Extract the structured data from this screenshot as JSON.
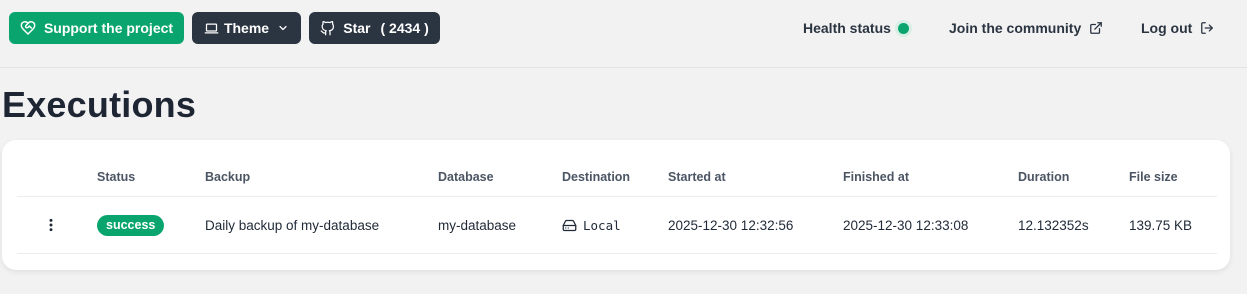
{
  "topbar": {
    "support_label": "Support the project",
    "theme_label": "Theme",
    "star_label": "Star",
    "star_count": "( 2434 )",
    "health_label": "Health status",
    "community_label": "Join the community",
    "logout_label": "Log out"
  },
  "colors": {
    "accent": "#0aa56f",
    "dark_button": "#2b3441",
    "background": "#f2f2f2"
  },
  "page": {
    "title": "Executions"
  },
  "table": {
    "columns": [
      "Status",
      "Backup",
      "Database",
      "Destination",
      "Started at",
      "Finished at",
      "Duration",
      "File size"
    ],
    "rows": [
      {
        "status": "success",
        "backup": "Daily backup of my-database",
        "database": "my-database",
        "destination": "Local",
        "destination_icon": "hard-drive-icon",
        "started_at": "2025-12-30 12:32:56",
        "finished_at": "2025-12-30 12:33:08",
        "duration": "12.132352s",
        "file_size": "139.75 KB"
      }
    ]
  }
}
